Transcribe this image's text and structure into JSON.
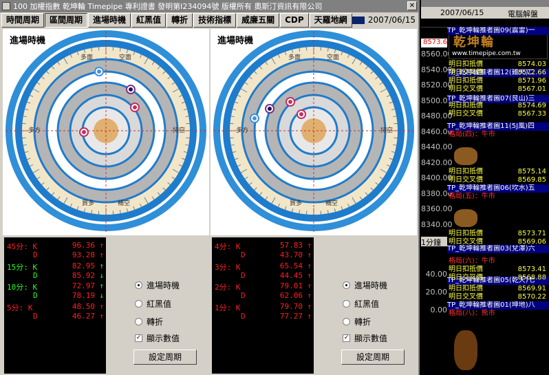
{
  "window": {
    "title": "100 加權指數  乾坤輪 Timepipe 專利證書 發明第I234094號 版權所有 奧斯汀資訊有限公司",
    "date": "2007/06/15"
  },
  "tabs": [
    "時間周期",
    "區間周期",
    "進場時機",
    "紅黑值",
    "轉折",
    "技術指標",
    "威廉五關",
    "CDP",
    "天羅地網"
  ],
  "active_tab": 1,
  "panels": [
    {
      "title": "進場時機"
    },
    {
      "title": "進場時機"
    }
  ],
  "dial_labels": {
    "top": [
      "多面",
      "空面"
    ],
    "left": "多方",
    "right": "持空",
    "bottom": [
      "買多",
      "補空"
    ]
  },
  "ind_left": [
    {
      "label": "45分: K",
      "value": "96.36",
      "arrow": "↑",
      "lc": "#ff2020",
      "ac": "#ff2020"
    },
    {
      "label": "D",
      "value": "93.28",
      "arrow": "↑",
      "lc": "#ff2020",
      "ac": "#ff2020"
    },
    {
      "label": "15分: K",
      "value": "82.95",
      "arrow": "↑",
      "lc": "#20ff20",
      "ac": "#20ff20"
    },
    {
      "label": "D",
      "value": "85.92",
      "arrow": "↓",
      "lc": "#20ff20",
      "ac": "#20ff20"
    },
    {
      "label": "10分: K",
      "value": "72.97",
      "arrow": "↑",
      "lc": "#20ff20",
      "ac": "#20ff20"
    },
    {
      "label": "D",
      "value": "78.19",
      "arrow": "↓",
      "lc": "#20ff20",
      "ac": "#20ff20"
    },
    {
      "label": "5分: K",
      "value": "48.50",
      "arrow": "↑",
      "lc": "#ff2020",
      "ac": "#ff2020"
    },
    {
      "label": "D",
      "value": "46.27",
      "arrow": "↑",
      "lc": "#ff2020",
      "ac": "#ff2020"
    }
  ],
  "ind_right": [
    {
      "label": "4分: K",
      "value": "57.83",
      "arrow": "↑",
      "lc": "#ff2020",
      "ac": "#ff2020"
    },
    {
      "label": "D",
      "value": "43.70",
      "arrow": "↑",
      "lc": "#ff2020",
      "ac": "#ff2020"
    },
    {
      "label": "3分: K",
      "value": "65.54",
      "arrow": "↑",
      "lc": "#ff2020",
      "ac": "#ff2020"
    },
    {
      "label": "D",
      "value": "44.45",
      "arrow": "↑",
      "lc": "#ff2020",
      "ac": "#ff2020"
    },
    {
      "label": "2分: K",
      "value": "79.01",
      "arrow": "↑",
      "lc": "#ff2020",
      "ac": "#ff2020"
    },
    {
      "label": "D",
      "value": "62.06",
      "arrow": "↑",
      "lc": "#ff2020",
      "ac": "#ff2020"
    },
    {
      "label": "1分: K",
      "value": "79.70",
      "arrow": "↑",
      "lc": "#ff2020",
      "ac": "#ff2020"
    },
    {
      "label": "D",
      "value": "77.27",
      "arrow": "↑",
      "lc": "#ff2020",
      "ac": "#ff2020"
    }
  ],
  "controls": {
    "radio_entry": "進場時機",
    "radio_redblack": "紅黑值",
    "radio_turn": "轉折",
    "chk_show": "顯示數值",
    "btn_period": "設定周期"
  },
  "right": {
    "date": "2007/06/15",
    "menu": "電腦解盤",
    "price_box": "8573.6",
    "axis": [
      "8560.00",
      "8540.00",
      "8520.00",
      "8500.00",
      "8480.00",
      "8460.00",
      "8440.00",
      "8420.00",
      "8400.00",
      "8380.00",
      "8360.00",
      "8340.00"
    ],
    "period": "1分鐘",
    "axis2": [
      "40.00",
      "20.00",
      "0.00"
    ],
    "logo": "乾坤輪",
    "url": "www.timepipe.com.tw",
    "headers": [
      "TP_乾坤輪推者圖09(震雷)一",
      "TP_乾坤輪推者圖12(雞火)二",
      "TP_乾坤輪推者圖07(艮山)三",
      "TP_乾坤輪推者圖11(5J風)四",
      "TP_乾坤輪推者圖06(坎水)五",
      "TP_乾坤輪推者圖03(兌澤)六",
      "TP_乾坤輪推者圖05(乾天)七",
      "TP_乾坤輪推者圖01(坤地)八"
    ],
    "rows": [
      [
        "明日扣抵價",
        "8574.03"
      ],
      [
        "明日交叉價",
        "8572.66"
      ],
      [
        "明日扣抵價",
        "8571.96"
      ],
      [
        "明日交叉價",
        "8567.01"
      ],
      [
        "明日扣抵價",
        "8574.69"
      ],
      [
        "明日交叉價",
        "8567.33"
      ],
      [
        "格局(四)：牛市",
        ""
      ],
      [
        "明日扣抵價",
        "8575.14"
      ],
      [
        "明日交叉價",
        "8569.85"
      ],
      [
        "格局(五)：牛市",
        ""
      ],
      [
        "明日扣抵價",
        "8573.71"
      ],
      [
        "明日交叉價",
        "8569.06"
      ],
      [
        "格局(六)：牛市",
        ""
      ],
      [
        "明日扣抵價",
        "8573.41"
      ],
      [
        "明日交叉價",
        "8568.88"
      ],
      [
        "明日扣抵價",
        "8569.91"
      ],
      [
        "明日交叉價",
        "8570.22"
      ],
      [
        "格局(八)：熊市",
        ""
      ]
    ]
  }
}
